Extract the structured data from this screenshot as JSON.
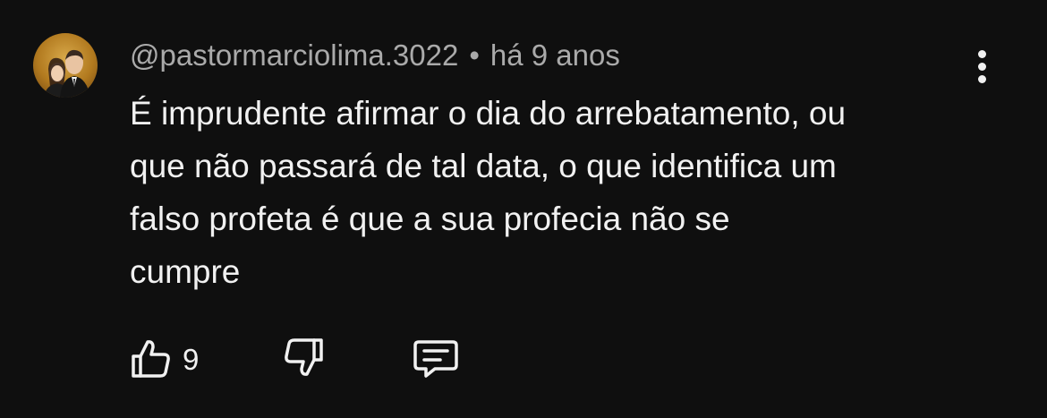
{
  "comment": {
    "author": "@pastormarciolima.3022",
    "separator": "•",
    "time": "há 9 anos",
    "text_lines": [
      "É imprudente afirmar o dia do arrebatamento, ou",
      "que não passará de tal data, o que identifica um",
      "falso profeta é que a sua profecia não se",
      "cumpre"
    ],
    "likes": "9"
  },
  "icons": {
    "avatar": "user-avatar",
    "more": "more-vert-icon",
    "like": "thumb-up-icon",
    "dislike": "thumb-down-icon",
    "reply": "reply-comment-icon"
  },
  "colors": {
    "background": "#0f0f0f",
    "primary_text": "#f1f1f1",
    "secondary_text": "#aaaaaa"
  }
}
